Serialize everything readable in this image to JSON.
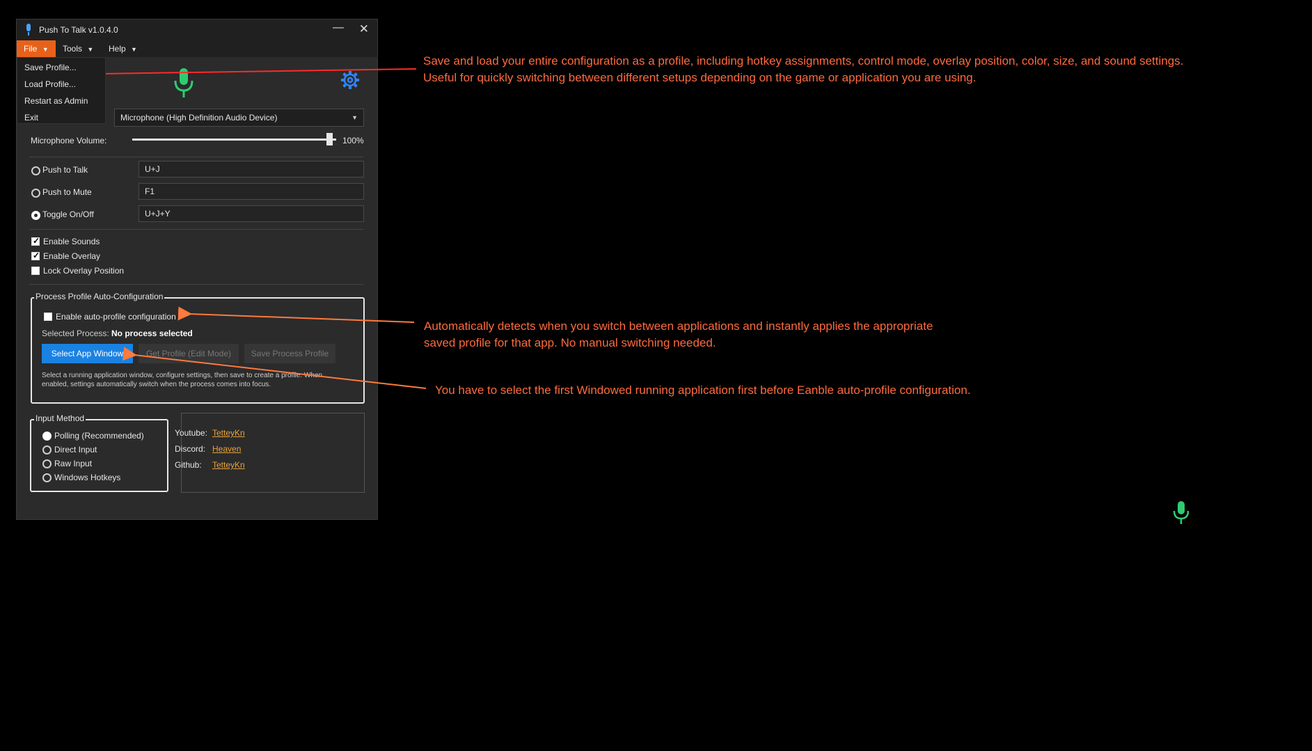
{
  "window": {
    "title": "Push To Talk v1.0.4.0",
    "minimize_glyph": "—",
    "close_glyph": "✕"
  },
  "menubar": {
    "file": "File",
    "tools": "Tools",
    "help": "Help",
    "caret": "▼"
  },
  "file_menu": {
    "items": [
      "Save Profile...",
      "Load Profile...",
      "Restart as Admin",
      "Exit"
    ]
  },
  "device": {
    "selected": "Microphone (High Definition Audio Device)"
  },
  "volume": {
    "label": "Microphone Volume:",
    "value_text": "100%",
    "value": 100
  },
  "modes": [
    {
      "label": "Push to Talk",
      "hotkey": "U+J"
    },
    {
      "label": "Push to Mute",
      "hotkey": "F1"
    },
    {
      "label": "Toggle On/Off",
      "hotkey": "U+J+Y"
    }
  ],
  "options": [
    {
      "label": "Enable Sounds",
      "checked": true
    },
    {
      "label": "Enable Overlay",
      "checked": true
    },
    {
      "label": "Lock Overlay Position",
      "checked": false
    }
  ],
  "auto_profile": {
    "title": "Process Profile Auto-Configuration",
    "enable_label": "Enable auto-profile configuration",
    "selected_process_label": "Selected Process:",
    "selected_process_value": "No process selected",
    "select_button": "Select App Window",
    "get_button": "Get Profile (Edit Mode)",
    "save_button": "Save Process Profile",
    "description_line1": "Select a running application window, configure settings, then save to create a profile. When",
    "description_line2": "enabled, settings automatically switch when the process comes into focus."
  },
  "input_method": {
    "title": "Input Method",
    "options": [
      "Polling (Recommended)",
      "Direct Input",
      "Raw Input",
      "Windows Hotkeys"
    ]
  },
  "links": [
    {
      "label": "Youtube:",
      "value": "TetteyKn"
    },
    {
      "label": "Discord:",
      "value": "Heaven"
    },
    {
      "label": "Github:",
      "value": "TetteyKn"
    }
  ],
  "annotations": {
    "profile_line1": "Save and load your entire configuration as a profile, including hotkey assignments, control mode, overlay position, color, size, and sound settings.",
    "profile_line2": "Useful for quickly switching between different setups depending on the game or application you are using.",
    "auto_line1": "Automatically detects when you switch between applications and instantly applies the appropriate",
    "auto_line2": "saved profile for that app. No manual switching needed.",
    "select_line": "You have to select the first Windowed running application first before Eanble auto-profile configuration."
  },
  "colors": {
    "accent_orange": "#e8611a",
    "annotation": "#ff6a3d",
    "mic_green": "#2ecc71",
    "primary_blue": "#1a82e2",
    "link": "#e8a23a"
  },
  "icons": [
    "app-mic-icon",
    "mic-icon",
    "gear-icon",
    "overlay-mic-icon"
  ]
}
